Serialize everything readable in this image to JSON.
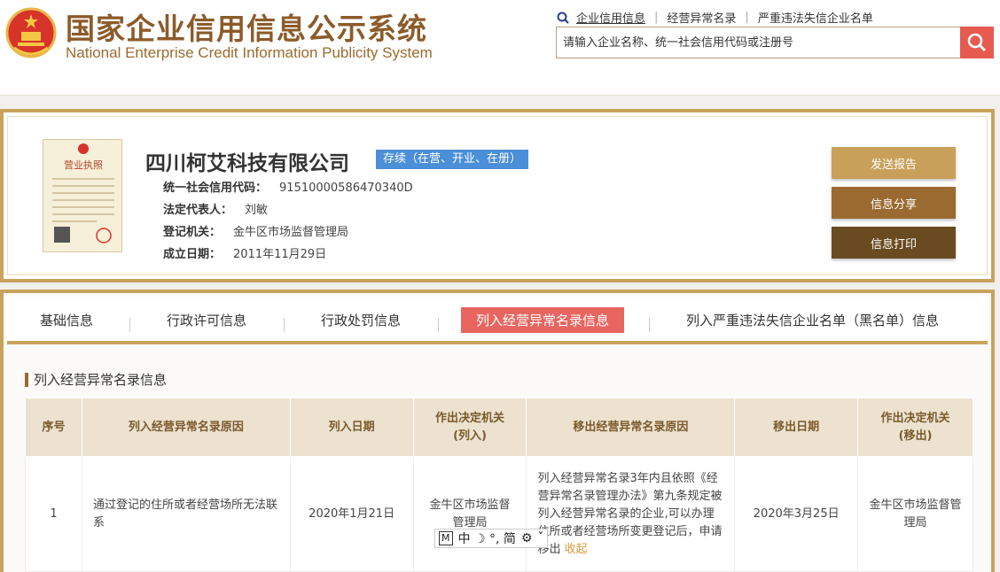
{
  "header": {
    "title_cn": "国家企业信用信息公示系统",
    "title_en": "National Enterprise Credit Information Publicity System",
    "links": [
      "企业信用信息",
      "经营异常名录",
      "严重违法失信企业名单"
    ],
    "search_placeholder": "请输入企业名称、统一社会信用代码或注册号"
  },
  "company": {
    "name": "四川柯艾科技有限公司",
    "status": "存续（在营、开业、在册）",
    "license_label": "营业执照",
    "fields": [
      {
        "label": "统一社会信用代码：",
        "value": "91510000586470340D"
      },
      {
        "label": "法定代表人：",
        "value": "刘敏"
      },
      {
        "label": "登记机关：",
        "value": "金牛区市场监督管理局"
      },
      {
        "label": "成立日期：",
        "value": "2011年11月29日"
      }
    ],
    "buttons": {
      "send": "发送报告",
      "share": "信息分享",
      "print": "信息打印"
    }
  },
  "tabs": [
    "基础信息",
    "行政许可信息",
    "行政处罚信息",
    "列入经营异常名录信息",
    "列入严重违法失信企业名单（黑名单）信息"
  ],
  "active_tab": 3,
  "section": {
    "title": "列入经营异常名录信息",
    "columns": [
      "序号",
      "列入经营异常名录原因",
      "列入日期",
      "作出决定机关\n(列入)",
      "移出经营异常名录原因",
      "移出日期",
      "作出决定机关\n(移出)"
    ],
    "rows": [
      {
        "index": "1",
        "reason_in": "通过登记的住所或者经营场所无法联系",
        "date_in": "2020年1月21日",
        "authority_in": "金牛区市场监督管理局",
        "reason_out": "列入经营异常名录3年内且依照《经营异常名录管理办法》第九条规定被列入经营异常名录的企业,可以办理住所或者经营场所变更登记后，申请移出",
        "collapse": "收起",
        "date_out": "2020年3月25日",
        "authority_out": "金牛区市场监督管理局"
      }
    ]
  },
  "ime": {
    "mode": "M",
    "chars": "中 ☽ °, 简"
  },
  "colors": {
    "gold": "#c9a35c",
    "brown": "#8c5b2a",
    "search_red": "#e65a4f",
    "tab_active": "#e86560",
    "status_blue": "#4a8fd8"
  }
}
